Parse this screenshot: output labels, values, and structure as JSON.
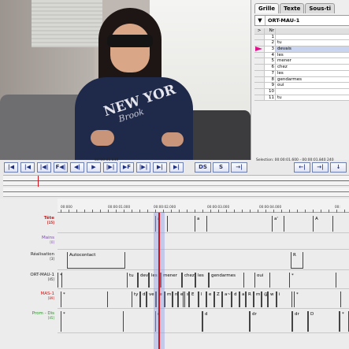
{
  "panel": {
    "tabs": [
      "Grille",
      "Texte",
      "Sous-ti"
    ],
    "active_tab": "Grille",
    "tier_name": "ORT-MAU-1",
    "chevron": "▼",
    "grid_headers": [
      ">",
      "Nr"
    ],
    "grid_rows": [
      {
        "nr": "1",
        "value": ""
      },
      {
        "nr": "2",
        "value": "tu"
      },
      {
        "nr": "3",
        "value": "devais"
      },
      {
        "nr": "4",
        "value": "les"
      },
      {
        "nr": "5",
        "value": "mener"
      },
      {
        "nr": "6",
        "value": "chez"
      },
      {
        "nr": "7",
        "value": "les"
      },
      {
        "nr": "8",
        "value": "gendarmes"
      },
      {
        "nr": "9",
        "value": "oui"
      },
      {
        "nr": "10",
        "value": ""
      },
      {
        "nr": "11",
        "value": "tu"
      }
    ],
    "current_row": 2
  },
  "video": {
    "shirt_text": "NEW YOR",
    "shirt_text2": "Brook"
  },
  "times": {
    "current": "00:00:01.640",
    "selection": "Selection: 00:00:01.600 - 00:00:01.840  240"
  },
  "controls": {
    "transport": [
      "|◀",
      "|◀",
      "|◀|",
      "F◀|",
      "◀|",
      "▶",
      "|▶|",
      "▶F",
      "|▶|",
      "▶|",
      "▶|"
    ],
    "selection": [
      "DS",
      "S",
      "→|"
    ],
    "nav": [
      "←|",
      "→|",
      "↓"
    ]
  },
  "timeline": {
    "ticks": [
      "00:000",
      "00:00:01.000",
      "00:00:02.000",
      "00:00:03.000",
      "00:00:04.000",
      "00:"
    ]
  },
  "tiers": [
    {
      "name": "Tête",
      "count": "[15]",
      "style": "red",
      "annotations": [
        "a",
        "a",
        "a'",
        "A"
      ]
    },
    {
      "name": "Mains",
      "count": "[0]",
      "style": "purple",
      "annotations": []
    },
    {
      "name": "Réalisation",
      "count": "[3]",
      "style": "dark",
      "annotations": [
        "Autocontact",
        "R"
      ]
    },
    {
      "name": "ORT-MAU-1",
      "count": "[45]",
      "style": "dark",
      "annotations": [
        "*",
        "tu",
        "devais",
        "les",
        "mener",
        "chez",
        "les",
        "gendarmes",
        "oui",
        "*"
      ]
    },
    {
      "name": "MAS-1",
      "count": "[89]",
      "style": "redthin",
      "annotations": [
        "*",
        "ty",
        "d",
        "ve",
        "le",
        "m",
        "n",
        "e",
        "s",
        "E",
        "l",
        "e",
        "Z",
        "a~",
        "d",
        "a",
        "R",
        "m",
        "@",
        "w",
        "i",
        "*"
      ]
    },
    {
      "name": "Prom - Dis",
      "count": "[45]",
      "style": "green",
      "annotations": [
        "*",
        "d",
        "d",
        "dr",
        "dr",
        "D",
        "*"
      ]
    }
  ]
}
